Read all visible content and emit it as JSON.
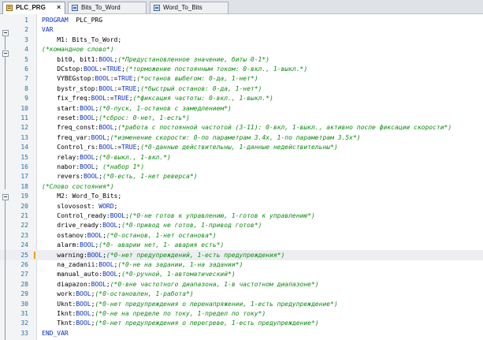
{
  "tabs": [
    {
      "label": "PLC_PRG",
      "active": true,
      "close": "×"
    },
    {
      "label": "Bits_To_Word",
      "active": false
    },
    {
      "label": "Word_To_Bits",
      "active": false
    }
  ],
  "editor": {
    "highlight_line": 25,
    "lines": [
      {
        "n": "1",
        "segs": [
          [
            "kw",
            "PROGRAM"
          ],
          [
            "",
            "  PLC_PRG"
          ]
        ]
      },
      {
        "n": "2",
        "segs": [
          [
            "kw",
            "VAR"
          ]
        ]
      },
      {
        "n": "3",
        "segs": [
          [
            "",
            "    M1: Bits_To_Word;"
          ]
        ]
      },
      {
        "n": "4",
        "segs": [
          [
            "cm",
            "(*командное слово*)"
          ]
        ]
      },
      {
        "n": "5",
        "segs": [
          [
            "",
            "    bit0, bit1:"
          ],
          [
            "kw",
            "BOOL"
          ],
          [
            "",
            ";"
          ],
          [
            "cm",
            "(*Предустановленное значение, биты 0-1*)"
          ]
        ]
      },
      {
        "n": "6",
        "segs": [
          [
            "",
            "    DCstop:"
          ],
          [
            "kw",
            "BOOL"
          ],
          [
            "",
            ":="
          ],
          [
            "kw",
            "TRUE"
          ],
          [
            "",
            ";"
          ],
          [
            "cm",
            "(*торможение постоянным током: 0-вкл., 1-выкл.*)"
          ]
        ]
      },
      {
        "n": "7",
        "segs": [
          [
            "",
            "    VYBEGstop:"
          ],
          [
            "kw",
            "BOOL"
          ],
          [
            "",
            ":="
          ],
          [
            "kw",
            "TRUE"
          ],
          [
            "",
            ";"
          ],
          [
            "cm",
            "(*останов выбегом: 0-да, 1-нет*)"
          ]
        ]
      },
      {
        "n": "8",
        "segs": [
          [
            "",
            "    bystr_stop:"
          ],
          [
            "kw",
            "BOOL"
          ],
          [
            "",
            ":="
          ],
          [
            "kw",
            "TRUE"
          ],
          [
            "",
            ";"
          ],
          [
            "cm",
            "(*быстрый останов: 0-да, 1-нет*)"
          ]
        ]
      },
      {
        "n": "9",
        "segs": [
          [
            "",
            "    fix_freq:"
          ],
          [
            "kw",
            "BOOL"
          ],
          [
            "",
            ":="
          ],
          [
            "kw",
            "TRUE"
          ],
          [
            "",
            ";"
          ],
          [
            "cm",
            "(*фиксация частоты: 0-вкл., 1-выкл.*)"
          ]
        ]
      },
      {
        "n": "10",
        "segs": [
          [
            "",
            "    start:"
          ],
          [
            "kw",
            "BOOL"
          ],
          [
            "",
            ";"
          ],
          [
            "cm",
            "(*0-пуск, 1-останов с замедлением*)"
          ]
        ]
      },
      {
        "n": "11",
        "segs": [
          [
            "",
            "    reset:"
          ],
          [
            "kw",
            "BOOL"
          ],
          [
            "",
            ";"
          ],
          [
            "cm",
            "(*сброс: 0-нет, 1-есть*)"
          ]
        ]
      },
      {
        "n": "12",
        "segs": [
          [
            "",
            "    freq_const:"
          ],
          [
            "kw",
            "BOOL"
          ],
          [
            "",
            ";"
          ],
          [
            "cm",
            "(*работа с постоянной частотой (3-11): 0-вкл, 1-выкл., активно после фиксации скорости*)"
          ]
        ]
      },
      {
        "n": "13",
        "segs": [
          [
            "",
            "    freq_var:"
          ],
          [
            "kw",
            "BOOL"
          ],
          [
            "",
            ";"
          ],
          [
            "cm",
            "(*изменение скорости: 0-по параметрам 3.4x, 1-по параметрам 3.5x*)"
          ]
        ]
      },
      {
        "n": "14",
        "segs": [
          [
            "",
            "    Control_rs:"
          ],
          [
            "kw",
            "BOOL"
          ],
          [
            "",
            ":="
          ],
          [
            "kw",
            "TRUE"
          ],
          [
            "",
            ";"
          ],
          [
            "cm",
            "(*0-данные действительны, 1-данные недействительны*)"
          ]
        ]
      },
      {
        "n": "15",
        "segs": [
          [
            "",
            "    relay:"
          ],
          [
            "kw",
            "BOOL"
          ],
          [
            "",
            ";"
          ],
          [
            "cm",
            "(*0-выкл., 1-вкл.*)"
          ]
        ]
      },
      {
        "n": "16",
        "segs": [
          [
            "",
            "    nabor:"
          ],
          [
            "kw",
            "BOOL"
          ],
          [
            "",
            "; "
          ],
          [
            "cm",
            "(*набор 1*)"
          ]
        ]
      },
      {
        "n": "17",
        "segs": [
          [
            "",
            "    revers:"
          ],
          [
            "kw",
            "BOOL"
          ],
          [
            "",
            ";"
          ],
          [
            "cm",
            "(*0-есть, 1-нет реверса*)"
          ]
        ]
      },
      {
        "n": "18",
        "segs": [
          [
            "cm",
            "(*Слово состояния*)"
          ]
        ]
      },
      {
        "n": "19",
        "segs": [
          [
            "",
            "    M2: Word_To_Bits;"
          ]
        ]
      },
      {
        "n": "20",
        "segs": [
          [
            "",
            "    slovosost: "
          ],
          [
            "kw",
            "WORD"
          ],
          [
            "",
            ";"
          ]
        ]
      },
      {
        "n": "21",
        "segs": [
          [
            "",
            "    Control_ready:"
          ],
          [
            "kw",
            "BOOL"
          ],
          [
            "",
            ";"
          ],
          [
            "cm",
            "(*0-не готов к управлению, 1-готов к управлению*)"
          ]
        ]
      },
      {
        "n": "22",
        "segs": [
          [
            "",
            "    drive_ready:"
          ],
          [
            "kw",
            "BOOL"
          ],
          [
            "",
            ";"
          ],
          [
            "cm",
            "(*0-привод не готов, 1-привод готов*)"
          ]
        ]
      },
      {
        "n": "23",
        "segs": [
          [
            "",
            "    ostanov:"
          ],
          [
            "kw",
            "BOOL"
          ],
          [
            "",
            ";"
          ],
          [
            "cm",
            "(*0-останов, 1-нет останова*)"
          ]
        ]
      },
      {
        "n": "24",
        "segs": [
          [
            "",
            "    alarm:"
          ],
          [
            "kw",
            "BOOL"
          ],
          [
            "",
            ";"
          ],
          [
            "cm",
            "(*0- аварии нет, 1- авария есть*)"
          ]
        ]
      },
      {
        "n": "25",
        "segs": [
          [
            "",
            "    warning:"
          ],
          [
            "kw",
            "BOOL"
          ],
          [
            "",
            ";"
          ],
          [
            "cm",
            "(*0-нет предупреждений, 1-есть предупреждения*)"
          ]
        ]
      },
      {
        "n": "26",
        "segs": [
          [
            "",
            "    na_zadanii:"
          ],
          [
            "kw",
            "BOOL"
          ],
          [
            "",
            ";"
          ],
          [
            "cm",
            "(*0-не на задании, 1-на задании*)"
          ]
        ]
      },
      {
        "n": "27",
        "segs": [
          [
            "",
            "    manual_auto:"
          ],
          [
            "kw",
            "BOOL"
          ],
          [
            "",
            ";"
          ],
          [
            "cm",
            "(*0-ручной, 1-автоматический*)"
          ]
        ]
      },
      {
        "n": "28",
        "segs": [
          [
            "",
            "    diapazon:"
          ],
          [
            "kw",
            "BOOL"
          ],
          [
            "",
            ";"
          ],
          [
            "cm",
            "(*0-вне частотного диапазона, 1-в частотном диапазоне*)"
          ]
        ]
      },
      {
        "n": "29",
        "segs": [
          [
            "",
            "    work:"
          ],
          [
            "kw",
            "BOOL"
          ],
          [
            "",
            ";"
          ],
          [
            "cm",
            "(*0-остановлен, 1-работа*)"
          ]
        ]
      },
      {
        "n": "30",
        "segs": [
          [
            "",
            "    Uknt:"
          ],
          [
            "kw",
            "BOOL"
          ],
          [
            "",
            ";"
          ],
          [
            "cm",
            "(*0-нет предупреждения о перенапряжении, 1-есть предупреждение*)"
          ]
        ]
      },
      {
        "n": "31",
        "segs": [
          [
            "",
            "    Iknt:"
          ],
          [
            "kw",
            "BOOL"
          ],
          [
            "",
            ";"
          ],
          [
            "cm",
            "(*0-не на пределе по току, 1-предел по току*)"
          ]
        ]
      },
      {
        "n": "32",
        "segs": [
          [
            "",
            "    Tknt:"
          ],
          [
            "kw",
            "BOOL"
          ],
          [
            "",
            ";"
          ],
          [
            "cm",
            "(*0-нет предупреждения о перегреве, 1-есть предупреждение*)"
          ]
        ]
      },
      {
        "n": "33",
        "segs": [
          [
            "kw",
            "END_VAR"
          ]
        ]
      }
    ]
  },
  "colors": {
    "keyword": "#0a2fbf",
    "comment": "#0e8b12",
    "line_number": "#2b6f9a"
  },
  "icons": {
    "tab_icon": "program-icon",
    "fold": "fold-minus-icon"
  }
}
